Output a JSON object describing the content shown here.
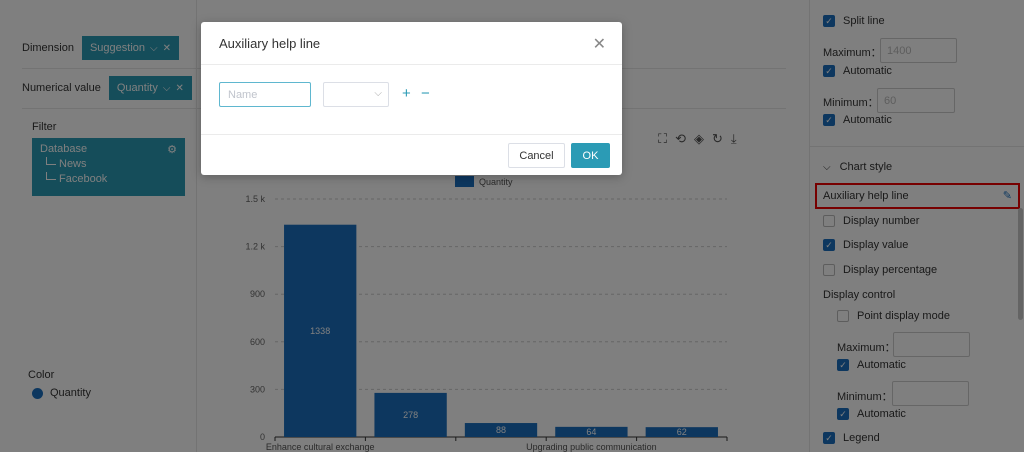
{
  "dimension": {
    "label": "Dimension",
    "tag": "Suggestion"
  },
  "numerical": {
    "label": "Numerical value",
    "tag": "Quantity"
  },
  "filter": {
    "label": "Filter",
    "root": "Database",
    "children": [
      "News",
      "Facebook"
    ]
  },
  "color": {
    "label": "Color",
    "item": "Quantity",
    "swatch": "#1a6fbf"
  },
  "legend_label": "Quantity",
  "chart_data": {
    "type": "bar",
    "categories": [
      "Enhance cultural exchange",
      "",
      "",
      "Upgrading public communication",
      ""
    ],
    "values": [
      1338,
      278,
      88,
      64,
      62
    ],
    "data_labels": [
      "1338",
      "278",
      "88",
      "64",
      "62"
    ],
    "yticks": [
      "0",
      "300",
      "600",
      "900",
      "1.2 k",
      "1.5 k"
    ],
    "ytick_values": [
      0,
      300,
      600,
      900,
      1200,
      1500
    ],
    "ylim": [
      0,
      1500
    ],
    "series": [
      {
        "name": "Quantity",
        "values": [
          1338,
          278,
          88,
          64,
          62
        ]
      }
    ],
    "bar_color": "#1a6fbf",
    "legend": "top"
  },
  "modal": {
    "title": "Auxiliary help line",
    "name_placeholder": "Name",
    "cancel_label": "Cancel",
    "ok_label": "OK"
  },
  "right_panel": {
    "split_line": "Split line",
    "maximum_label": "Maximum：",
    "maximum_value": "1400",
    "automatic": "Automatic",
    "minimum_label": "Minimum：",
    "minimum_value": "60",
    "chart_style": "Chart style",
    "aux_help_line": "Auxiliary help line",
    "display_number": "Display number",
    "display_value": "Display value",
    "display_percentage": "Display percentage",
    "display_control": "Display control",
    "point_display_mode": "Point display mode",
    "legend": "Legend"
  },
  "accent": "#2b9bb5"
}
